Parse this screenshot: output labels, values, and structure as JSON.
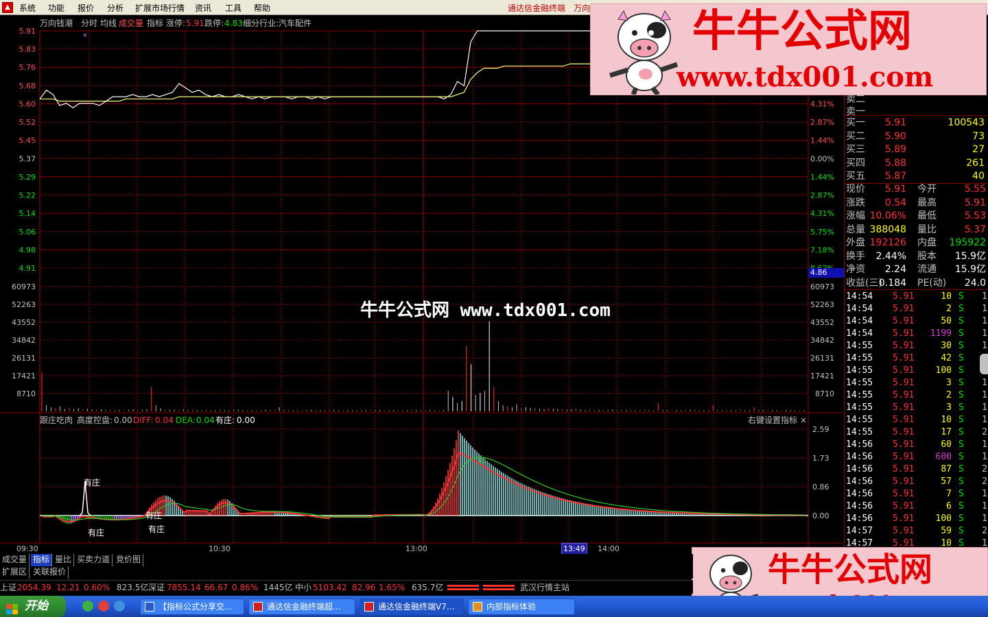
{
  "menu": {
    "items": [
      "系统",
      "功能",
      "报价",
      "分析",
      "扩展市场行情",
      "资讯",
      "工具",
      "帮助"
    ],
    "brand": "通达信金融终端",
    "brand2": "万向"
  },
  "chart_header": {
    "stock": "万向钱潮",
    "tab_time": "分时",
    "tab_avg": "均线",
    "tab_vol": "成交量",
    "tab_ind": "指标",
    "up_limit_label": "涨停:",
    "up_limit": "5.91",
    "down_limit_label": "跌停:",
    "down_limit": "4.83",
    "industry": "细分行业:汽车配件"
  },
  "chart_data": [
    {
      "type": "line",
      "title": "",
      "series": [
        {
          "name": "",
          "values": [
            5.6,
            5.64,
            5.62,
            5.57,
            5.58,
            5.56,
            5.58,
            5.58,
            5.58,
            5.57,
            5.59,
            5.61,
            5.61,
            5.61,
            5.62,
            5.61,
            5.61,
            5.62,
            5.61,
            5.62,
            5.63,
            5.67,
            5.65,
            5.63,
            5.64,
            5.62,
            5.61,
            5.62,
            5.61,
            5.61,
            5.62,
            5.61,
            5.6,
            5.61,
            5.6,
            5.61,
            5.61,
            5.61,
            5.6,
            5.61,
            5.61,
            5.6,
            5.61,
            5.6,
            5.61,
            5.61,
            5.61,
            5.61,
            5.61,
            5.61,
            5.61,
            5.61,
            5.61,
            5.61,
            5.61,
            5.61,
            5.61,
            5.61,
            5.61,
            5.61,
            5.61,
            5.6,
            5.62,
            5.68,
            5.66,
            5.86,
            5.91,
            5.91,
            5.91,
            5.91,
            5.91,
            5.91,
            5.91,
            5.91,
            5.91,
            5.91,
            5.91,
            5.91,
            5.91,
            5.91,
            5.91,
            5.91,
            5.91,
            5.91
          ]
        },
        {
          "name": "",
          "values": [
            5.6,
            5.6,
            5.6,
            5.59,
            5.59,
            5.59,
            5.59,
            5.59,
            5.59,
            5.59,
            5.59,
            5.59,
            5.59,
            5.6,
            5.6,
            5.6,
            5.6,
            5.6,
            5.6,
            5.6,
            5.6,
            5.61,
            5.61,
            5.61,
            5.61,
            5.61,
            5.61,
            5.61,
            5.61,
            5.61,
            5.61,
            5.61,
            5.61,
            5.61,
            5.61,
            5.61,
            5.61,
            5.61,
            5.61,
            5.61,
            5.61,
            5.61,
            5.61,
            5.61,
            5.61,
            5.61,
            5.61,
            5.61,
            5.61,
            5.61,
            5.61,
            5.61,
            5.61,
            5.61,
            5.61,
            5.61,
            5.61,
            5.61,
            5.61,
            5.61,
            5.61,
            5.61,
            5.61,
            5.62,
            5.63,
            5.69,
            5.72,
            5.74,
            5.74,
            5.74,
            5.75,
            5.75,
            5.75,
            5.75,
            5.75,
            5.75,
            5.75,
            5.75,
            5.75,
            5.75,
            5.76,
            5.76,
            5.76,
            5.76
          ]
        }
      ],
      "ylim": [
        4.83,
        5.91
      ],
      "yticks_left": [
        "5.91",
        "5.83",
        "5.76",
        "5.68",
        "5.60",
        "5.52",
        "5.45",
        "5.37",
        "5.29",
        "5.22",
        "5.14",
        "5.06",
        "4.98",
        "4.91"
      ],
      "yticks_right": [
        "4.31%",
        "2.87%",
        "1.44%",
        "0.00%",
        "1.44%",
        "2.87%",
        "4.31%",
        "5.75%",
        "7.18%",
        "8.62%"
      ],
      "cursor_price": "4.86"
    },
    {
      "type": "bar",
      "title": "",
      "values": [
        19000,
        3000,
        2000,
        1500,
        2500,
        1200,
        1800,
        1000,
        1500,
        800,
        1200,
        900,
        700,
        1000,
        600,
        800,
        500,
        700,
        400,
        600,
        900,
        500,
        700,
        1100,
        12000,
        3000,
        1500,
        900,
        800,
        700,
        600,
        900,
        500,
        700,
        600,
        400,
        800,
        500,
        600,
        700,
        600,
        500,
        700,
        800,
        600,
        700,
        500,
        400,
        600,
        800,
        500,
        600,
        2000,
        500,
        700,
        600,
        500,
        400,
        600,
        700,
        500,
        600,
        400,
        500,
        700,
        500,
        400,
        600,
        500,
        700,
        500,
        600,
        400,
        500,
        700,
        500,
        400,
        600,
        500,
        400,
        500,
        600,
        700,
        500,
        400,
        600,
        500,
        400,
        500,
        10000,
        7000,
        4000,
        5000,
        32000,
        23000,
        8000,
        9000,
        10000,
        44000,
        12000,
        5000,
        3000,
        2500,
        2000,
        3500,
        1500,
        2000,
        1800,
        1500,
        1200,
        1000,
        1500,
        1200,
        1000,
        900,
        800,
        1000,
        1200,
        700,
        600,
        800,
        500,
        700,
        500,
        600,
        800,
        500,
        400,
        600,
        700,
        500,
        400,
        600,
        500,
        400,
        4000,
        600,
        500,
        400,
        600,
        500,
        700,
        800,
        500,
        600,
        500,
        400,
        3000,
        500,
        400,
        600,
        500,
        400,
        700,
        500,
        400,
        2000,
        600,
        500,
        400,
        600,
        500,
        400,
        700,
        500,
        600,
        400,
        500
      ],
      "ylim": [
        0,
        60973
      ],
      "yticks": [
        "60973",
        "52263",
        "43552",
        "34842",
        "26131",
        "17421",
        "8710"
      ]
    },
    {
      "type": "bar",
      "title": "",
      "ind_name": "跟庄吃肉",
      "ind_values": [
        {
          "label": "高度控盘: ",
          "value": "0.00"
        },
        {
          "label": "DIFF: ",
          "value": "0.04"
        },
        {
          "label": "DEA: ",
          "value": "0.04"
        },
        {
          "label": "有庄: ",
          "value": "0.00"
        }
      ],
      "hint": "右键设置指标",
      "yticks": [
        "2.59",
        "1.73",
        "0.86",
        "0.00"
      ],
      "ylim": [
        -0.35,
        2.59
      ],
      "annotations": [
        "有庄",
        "有庄",
        "有庄",
        "有庄"
      ]
    }
  ],
  "time_axis": {
    "t0": "09:30",
    "t1": "10:30",
    "t2": "13:00",
    "cursor": "13:49",
    "t3": "14:00"
  },
  "quote": {
    "sell_rows": [
      {
        "label": "卖二"
      },
      {
        "label": "卖一"
      }
    ],
    "buy_rows": [
      {
        "label": "买一",
        "price": "5.91",
        "vol": "100543"
      },
      {
        "label": "买二",
        "price": "5.90",
        "vol": "73"
      },
      {
        "label": "买三",
        "price": "5.89",
        "vol": "27"
      },
      {
        "label": "买四",
        "price": "5.88",
        "vol": "261"
      },
      {
        "label": "买五",
        "price": "5.87",
        "vol": "40"
      }
    ],
    "stats": [
      {
        "l1": "现价",
        "v1": "5.91",
        "l2": "今开",
        "v2": "5.55"
      },
      {
        "l1": "涨跌",
        "v1": "0.54",
        "l2": "最高",
        "v2": "5.91"
      },
      {
        "l1": "涨幅",
        "v1": "10.06%",
        "l2": "最低",
        "v2": "5.53"
      },
      {
        "l1": "总量",
        "v1": "388048",
        "l2": "量比",
        "v2": "5.37"
      },
      {
        "l1": "外盘",
        "v1": "192126",
        "l2": "内盘",
        "v2": "195922"
      },
      {
        "l1": "换手",
        "v1": "2.44%",
        "l2": "股本",
        "v2": "15.9亿"
      },
      {
        "l1": "净资",
        "v1": "2.24",
        "l2": "流通",
        "v2": "15.9亿"
      },
      {
        "l1": "收益(三)",
        "v1": "0.184",
        "l2": "PE(动)",
        "v2": "24.0"
      }
    ],
    "ticks": [
      {
        "t": "14:54",
        "p": "5.91",
        "v": "10",
        "s": "S",
        "n": "1"
      },
      {
        "t": "14:54",
        "p": "5.91",
        "v": "2",
        "s": "S",
        "n": "1"
      },
      {
        "t": "14:54",
        "p": "5.91",
        "v": "50",
        "s": "S",
        "n": "1"
      },
      {
        "t": "14:54",
        "p": "5.91",
        "v": "1199",
        "s": "S",
        "n": "1"
      },
      {
        "t": "14:55",
        "p": "5.91",
        "v": "30",
        "s": "S",
        "n": "1"
      },
      {
        "t": "14:55",
        "p": "5.91",
        "v": "42",
        "s": "S",
        "n": "1"
      },
      {
        "t": "14:55",
        "p": "5.91",
        "v": "100",
        "s": "S",
        "n": "1"
      },
      {
        "t": "14:55",
        "p": "5.91",
        "v": "3",
        "s": "S",
        "n": "1"
      },
      {
        "t": "14:55",
        "p": "5.91",
        "v": "2",
        "s": "S",
        "n": "1"
      },
      {
        "t": "14:55",
        "p": "5.91",
        "v": "3",
        "s": "S",
        "n": "1"
      },
      {
        "t": "14:55",
        "p": "5.91",
        "v": "10",
        "s": "S",
        "n": "1"
      },
      {
        "t": "14:55",
        "p": "5.91",
        "v": "17",
        "s": "S",
        "n": "2"
      },
      {
        "t": "14:56",
        "p": "5.91",
        "v": "60",
        "s": "S",
        "n": "1"
      },
      {
        "t": "14:56",
        "p": "5.91",
        "v": "600",
        "s": "S",
        "n": "1"
      },
      {
        "t": "14:56",
        "p": "5.91",
        "v": "87",
        "s": "S",
        "n": "2"
      },
      {
        "t": "14:56",
        "p": "5.91",
        "v": "57",
        "s": "S",
        "n": "2"
      },
      {
        "t": "14:56",
        "p": "5.91",
        "v": "7",
        "s": "S",
        "n": "1"
      },
      {
        "t": "14:56",
        "p": "5.91",
        "v": "6",
        "s": "S",
        "n": "1"
      },
      {
        "t": "14:56",
        "p": "5.91",
        "v": "100",
        "s": "S",
        "n": "1"
      },
      {
        "t": "14:57",
        "p": "5.91",
        "v": "59",
        "s": "S",
        "n": "2"
      },
      {
        "t": "14:57",
        "p": "5.91",
        "v": "10",
        "s": "S",
        "n": "1"
      }
    ]
  },
  "tabs": {
    "row1": [
      "成交量",
      "指标",
      "量比",
      "买卖力道",
      "竞价图"
    ],
    "row2": [
      "扩展区",
      "关联报价"
    ]
  },
  "ticker": {
    "sh_label": "上证",
    "sh_val": "2054.39",
    "sh_chg": "12.21",
    "sh_pct": "0.60%",
    "sh_amt": "823.5亿",
    "sz_label": "深证",
    "sz_val": "7855.14",
    "sz_chg": "66.67",
    "sz_pct": "0.86%",
    "sz_amt": "1445亿",
    "zx_label": "中小",
    "zx_val": "5103.42",
    "zx_chg": "82.96",
    "zx_pct": "1.65%",
    "zx_amt": "635.7亿",
    "station": "武汉行情主站"
  },
  "taskbar": {
    "start": "开始",
    "tasks": [
      "【指标公式分享交…",
      "通达信金融终端超…",
      "通达信金融终端V7…",
      "内部指标体验"
    ]
  },
  "watermark": {
    "title": "牛牛公式网",
    "url": "www.tdx001.com",
    "center": "牛牛公式网 www.tdx001.com"
  },
  "colors": {
    "up": "#ff3232",
    "down": "#00e000",
    "grid": "#8b0000",
    "white": "#ffffff",
    "yellow": "#ffff00",
    "cyan": "#7fdfdf"
  }
}
